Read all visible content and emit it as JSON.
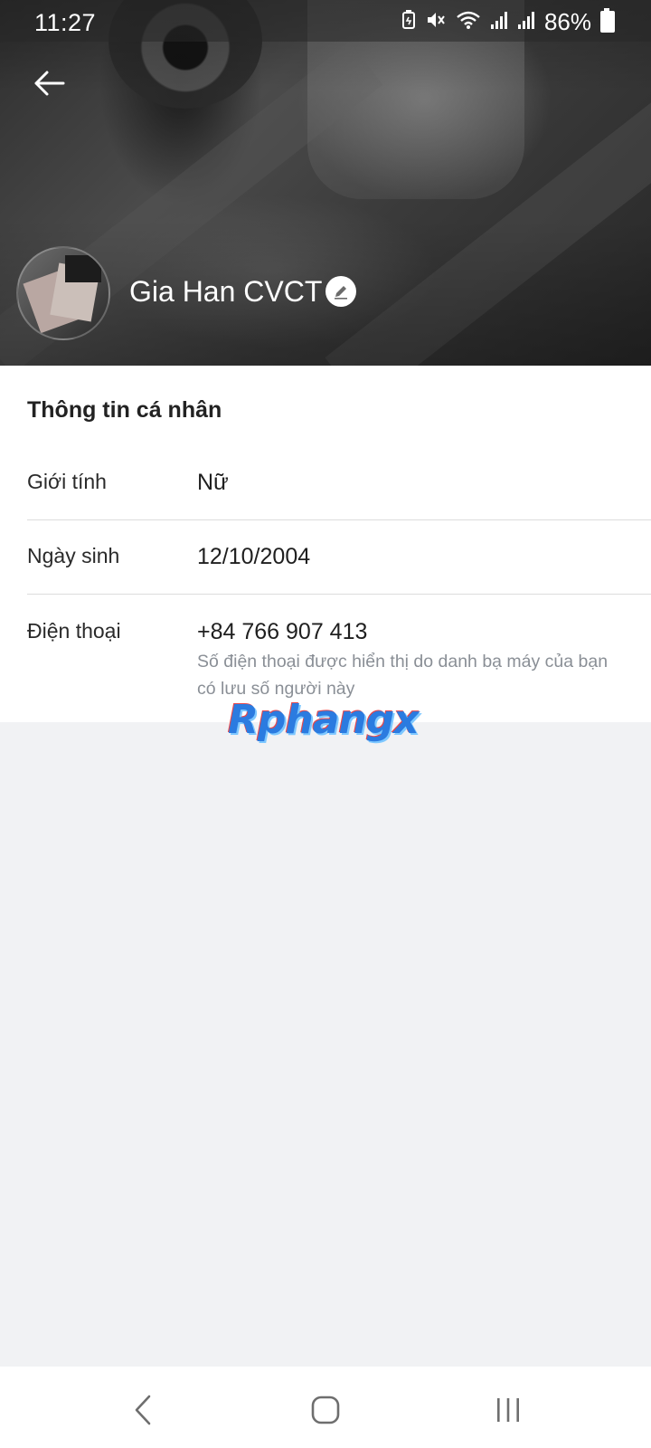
{
  "status_bar": {
    "time": "11:27",
    "battery": "86%",
    "icons": [
      "battery-saver-icon",
      "mute-icon",
      "wifi-icon",
      "signal-icon",
      "signal-icon",
      "battery-icon"
    ]
  },
  "header": {
    "profile_name": "Gia Han CVCT"
  },
  "personal_info": {
    "title": "Thông tin cá nhân",
    "rows": [
      {
        "label": "Giới tính",
        "value": "Nữ"
      },
      {
        "label": "Ngày sinh",
        "value": "12/10/2004"
      },
      {
        "label": "Điện thoại",
        "value": "+84 766 907 413"
      }
    ],
    "phone_note": "Số điện thoại được hiển thị do danh bạ máy của bạn có lưu số người này"
  },
  "watermark": {
    "text": "Rphangx"
  },
  "colors": {
    "background": "#f1f2f4",
    "card": "#ffffff",
    "note_text": "#8a8f96",
    "watermark_blue": "#2b7be0"
  }
}
